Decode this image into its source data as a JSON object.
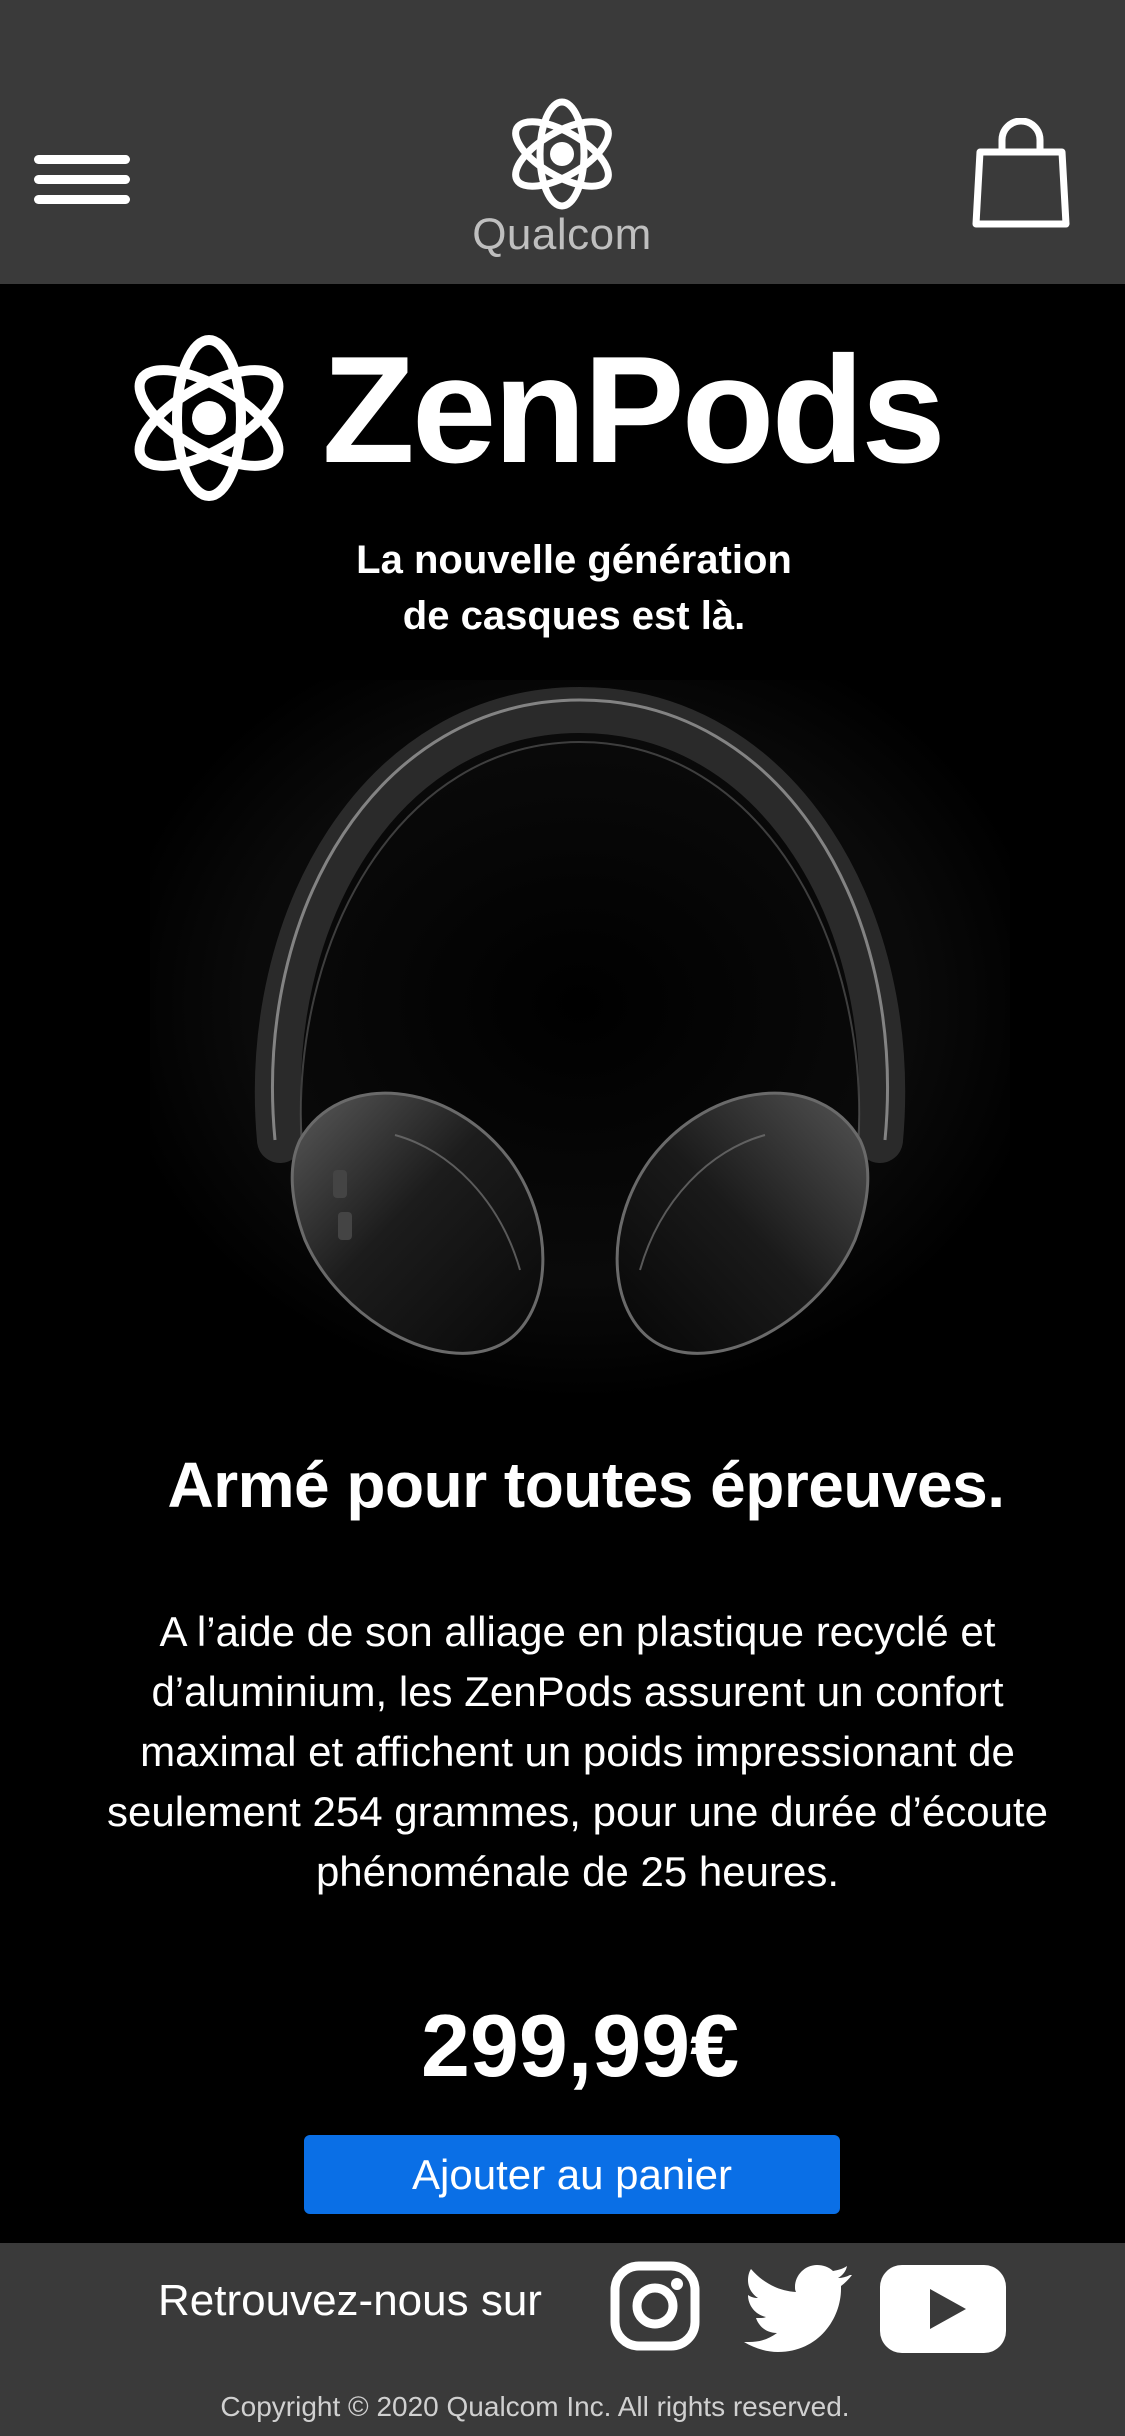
{
  "header": {
    "brand_name": "Qualcom"
  },
  "hero": {
    "product_name": "ZenPods",
    "tagline_line1": "La nouvelle génération",
    "tagline_line2": "de casques est là."
  },
  "feature": {
    "heading": "Armé pour toutes épreuves.",
    "description": "A l’aide de son alliage en plastique recyclé et d’aluminium, les ZenPods assurent un confort maximal et affichent un poids impressionant de seulement 254 grammes, pour une durée d’écoute phénoménale de 25 heures."
  },
  "purchase": {
    "price": "299,99€",
    "add_to_cart_label": "Ajouter au panier"
  },
  "footer": {
    "follow_label": "Retrouvez-nous sur",
    "social": [
      "instagram-icon",
      "twitter-icon",
      "youtube-icon"
    ],
    "copyright": "Copyright © 2020 Qualcom Inc. All rights reserved."
  },
  "colors": {
    "header_bg": "#3a3a3a",
    "page_bg": "#000000",
    "accent": "#0a6fe6"
  }
}
